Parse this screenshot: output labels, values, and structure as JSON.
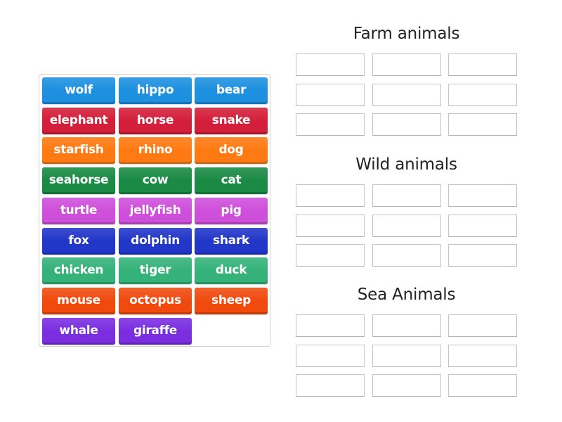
{
  "activity": {
    "type": "group-sort",
    "card_bank": {
      "cards": [
        {
          "label": "wolf",
          "color": "#1E90E0"
        },
        {
          "label": "hippo",
          "color": "#1E90E0"
        },
        {
          "label": "bear",
          "color": "#1E90E0"
        },
        {
          "label": "elephant",
          "color": "#D41F3A"
        },
        {
          "label": "horse",
          "color": "#D41F3A"
        },
        {
          "label": "snake",
          "color": "#D41F3A"
        },
        {
          "label": "starfish",
          "color": "#FF7A12"
        },
        {
          "label": "rhino",
          "color": "#FF7A12"
        },
        {
          "label": "dog",
          "color": "#FF7A12"
        },
        {
          "label": "seahorse",
          "color": "#1A8A45"
        },
        {
          "label": "cow",
          "color": "#1A8A45"
        },
        {
          "label": "cat",
          "color": "#1A8A45"
        },
        {
          "label": "turtle",
          "color": "#CE4FDA"
        },
        {
          "label": "jellyfish",
          "color": "#CE4FDA"
        },
        {
          "label": "pig",
          "color": "#CE4FDA"
        },
        {
          "label": "fox",
          "color": "#2236C8"
        },
        {
          "label": "dolphin",
          "color": "#2236C8"
        },
        {
          "label": "shark",
          "color": "#2236C8"
        },
        {
          "label": "chicken",
          "color": "#35B27A"
        },
        {
          "label": "tiger",
          "color": "#35B27A"
        },
        {
          "label": "duck",
          "color": "#35B27A"
        },
        {
          "label": "mouse",
          "color": "#F04A0E"
        },
        {
          "label": "octopus",
          "color": "#F04A0E"
        },
        {
          "label": "sheep",
          "color": "#F04A0E"
        },
        {
          "label": "whale",
          "color": "#7A2EE0"
        },
        {
          "label": "giraffe",
          "color": "#7A2EE0"
        }
      ]
    },
    "groups": [
      {
        "title": "Farm animals",
        "slot_count": 9
      },
      {
        "title": "Wild animals",
        "slot_count": 9
      },
      {
        "title": "Sea Animals",
        "slot_count": 9
      }
    ]
  }
}
